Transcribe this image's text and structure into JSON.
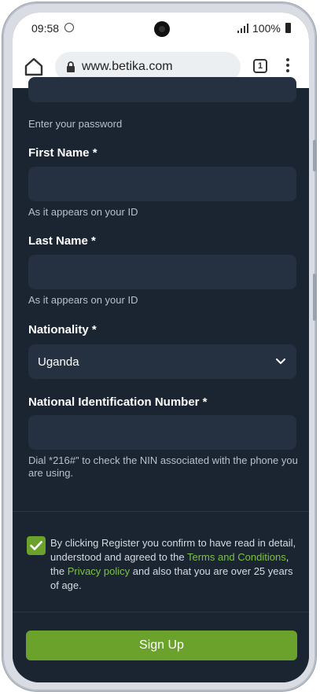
{
  "status_bar": {
    "time": "09:58",
    "battery": "100%"
  },
  "browser": {
    "url": "www.betika.com",
    "tab_count": "1"
  },
  "form": {
    "password_hint": "Enter your password",
    "first_name_label": "First Name *",
    "first_name_hint": "As it appears on your ID",
    "last_name_label": "Last Name *",
    "last_name_hint": "As it appears on your ID",
    "nationality_label": "Nationality *",
    "nationality_value": "Uganda",
    "nin_label": "National Identification Number *",
    "nin_hint": "Dial *216#\" to check the NIN associated with the phone you are using."
  },
  "consent": {
    "text_1": "By clicking Register you confirm to have read in detail, understood and agreed to the ",
    "terms_link": "Terms and Conditions",
    "text_2": ", the ",
    "privacy_link": "Privacy policy",
    "text_3": " and also that you are over 25 years of age."
  },
  "buttons": {
    "signup": "Sign Up"
  },
  "colors": {
    "accent": "#6aa22b",
    "background": "#1b2431",
    "input": "#253141"
  }
}
